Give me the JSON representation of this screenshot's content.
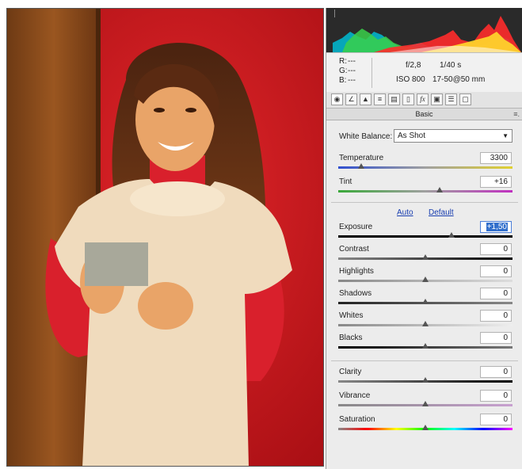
{
  "colors": {
    "accent": "#3370cc",
    "wall": "#c8141a",
    "door": "#8a4a1a",
    "shirt": "#d9202c",
    "sweater": "#efd8b8",
    "card": "#a8a89a"
  },
  "photo": {
    "subject": "woman-with-gray-card"
  },
  "histogram": {
    "colors": [
      "#00bcd4",
      "#3ad04a",
      "#ff2b2b",
      "#ffd92b",
      "#ffffff"
    ]
  },
  "info": {
    "r_label": "R:",
    "g_label": "G:",
    "b_label": "B:",
    "r_value": "---",
    "g_value": "---",
    "b_value": "---",
    "aperture": "f/2,8",
    "shutter": "1/40 s",
    "iso": "ISO 800",
    "lens": "17-50@50 mm"
  },
  "toolbar": {
    "icons": [
      "aperture-icon",
      "tone-curve-icon",
      "mountain-icon",
      "hsl-icon",
      "split-toning-icon",
      "lens-icon",
      "fx-icon",
      "camera-icon",
      "presets-icon",
      "snapshots-icon"
    ],
    "fx_label": "fx"
  },
  "section": {
    "title": "Basic",
    "menu_icon": "panel-menu-icon"
  },
  "white_balance": {
    "label": "White Balance:",
    "value": "As Shot"
  },
  "sliders_wb": [
    {
      "label": "Temperature",
      "value": "3300",
      "fraction": 0.13
    },
    {
      "label": "Tint",
      "value": "+16",
      "fraction": 0.58
    }
  ],
  "links": {
    "auto": "Auto",
    "default": "Default"
  },
  "sliders_tone": [
    {
      "label": "Exposure",
      "value": "+1,50",
      "fraction": 0.65,
      "selected": true
    },
    {
      "label": "Contrast",
      "value": "0",
      "fraction": 0.5
    },
    {
      "label": "Highlights",
      "value": "0",
      "fraction": 0.5
    },
    {
      "label": "Shadows",
      "value": "0",
      "fraction": 0.5
    },
    {
      "label": "Whites",
      "value": "0",
      "fraction": 0.5
    },
    {
      "label": "Blacks",
      "value": "0",
      "fraction": 0.5
    }
  ],
  "sliders_presence": [
    {
      "label": "Clarity",
      "value": "0",
      "fraction": 0.5
    },
    {
      "label": "Vibrance",
      "value": "0",
      "fraction": 0.5
    },
    {
      "label": "Saturation",
      "value": "0",
      "fraction": 0.5
    }
  ]
}
